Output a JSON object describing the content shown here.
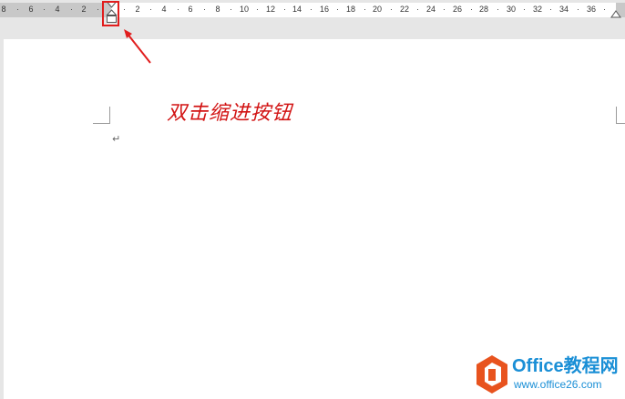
{
  "ruler": {
    "left_labels": [
      "8",
      "6",
      "4",
      "2"
    ],
    "right_labels": [
      "2",
      "4",
      "6",
      "8",
      "10",
      "12",
      "14",
      "16",
      "18",
      "20",
      "22",
      "24",
      "26",
      "28",
      "30",
      "32",
      "34",
      "36"
    ]
  },
  "annotation": {
    "text": "双击缩进按钮",
    "color": "#d21414"
  },
  "document": {
    "paragraph_mark": "↵"
  },
  "watermark": {
    "title": "Office教程网",
    "url": "www.office26.com",
    "brand_color": "#1a8fd6",
    "logo_color": "#e8531e"
  },
  "icons": {
    "first_line_indent": "first-line-indent-icon",
    "hanging_indent": "hanging-indent-icon",
    "left_indent": "left-indent-icon",
    "right_indent": "right-indent-icon"
  }
}
